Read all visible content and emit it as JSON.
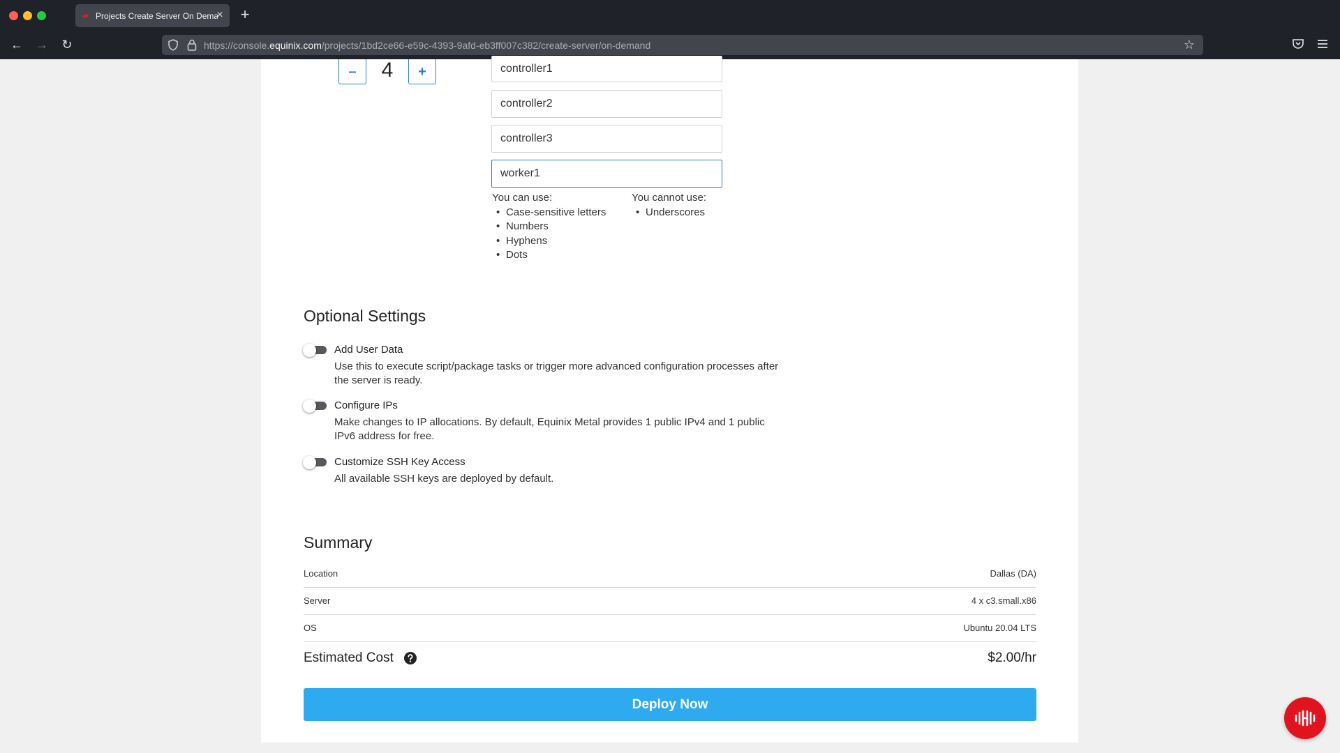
{
  "browser": {
    "tab_title": "Projects Create Server On Demand",
    "url_prefix": "https://console.",
    "url_domain": "equinix.com",
    "url_path": "/projects/1bd2ce66-e59c-4393-9afd-eb3ff007c382/create-server/on-demand",
    "tab_close": "×",
    "new_tab": "+"
  },
  "quantity": {
    "minus_label": "–",
    "value": "4",
    "plus_label": "+"
  },
  "hostnames": [
    "controller1",
    "controller2",
    "controller3",
    "worker1"
  ],
  "hostname_rules": {
    "can_title": "You can use:",
    "can_items": [
      "Case-sensitive letters",
      "Numbers",
      "Hyphens",
      "Dots"
    ],
    "cannot_title": "You cannot use:",
    "cannot_items": [
      "Underscores"
    ]
  },
  "optional_settings": {
    "title": "Optional Settings",
    "items": [
      {
        "title": "Add User Data",
        "description": "Use this to execute script/package tasks or trigger more advanced configuration processes after the server is ready.",
        "enabled": false
      },
      {
        "title": "Configure IPs",
        "description": "Make changes to IP allocations. By default, Equinix Metal provides 1 public IPv4 and 1 public IPv6 address for free.",
        "enabled": false
      },
      {
        "title": "Customize SSH Key Access",
        "description": "All available SSH keys are deployed by default.",
        "enabled": false
      }
    ]
  },
  "summary": {
    "title": "Summary",
    "rows": [
      {
        "label": "Location",
        "value": "Dallas (DA)"
      },
      {
        "label": "Server",
        "value": "4 x c3.small.x86"
      },
      {
        "label": "OS",
        "value": "Ubuntu 20.04 LTS"
      }
    ],
    "cost_label": "Estimated Cost",
    "cost_value": "$2.00/hr"
  },
  "deploy_label": "Deploy Now",
  "colors": {
    "accent": "#2eaaf0",
    "link": "#2b7bd5",
    "brand": "#e0141f"
  }
}
